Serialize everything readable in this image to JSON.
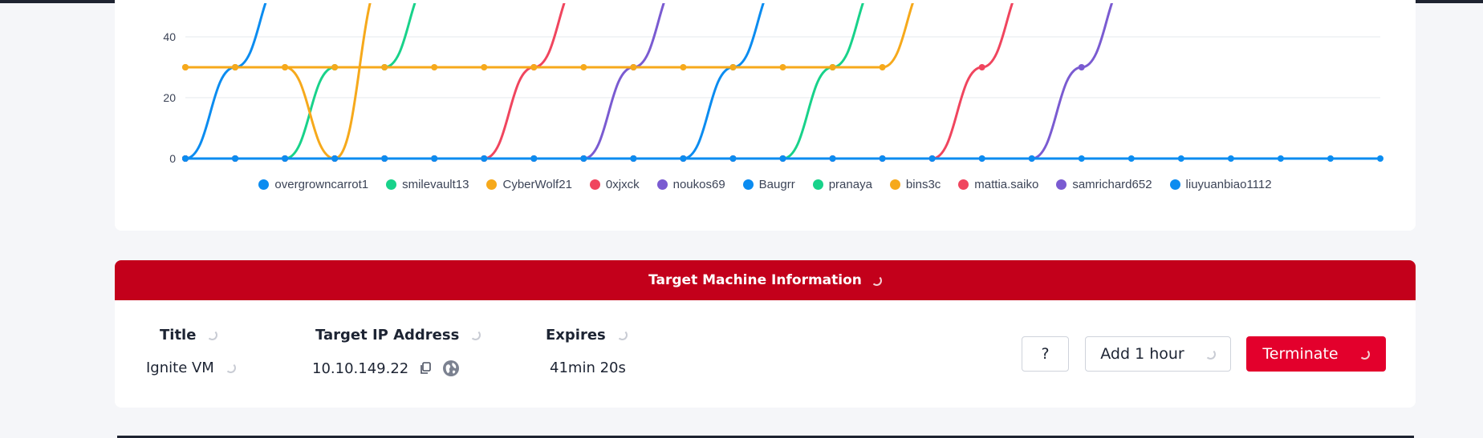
{
  "colors": {
    "blue": "#0b8cf0",
    "green": "#18d28a",
    "orange": "#f6a91b",
    "red": "#f0455e",
    "purple": "#7a5bd1",
    "header_red": "#c3001b",
    "terminate_red": "#e3002c"
  },
  "chart_data": {
    "type": "line",
    "y_ticks": [
      "0",
      "20",
      "40"
    ],
    "ylim": [
      0,
      50
    ],
    "x_count": 25,
    "grid": true,
    "legend_position": "bottom",
    "series": [
      {
        "name": "overgrowncarrot1",
        "color": "#0b8cf0",
        "values": [
          0,
          30,
          60,
          60,
          60,
          60,
          60,
          60,
          60,
          60,
          60,
          60,
          60,
          60,
          60,
          60,
          60,
          60,
          60,
          60,
          60,
          60,
          60,
          60,
          60
        ]
      },
      {
        "name": "smilevault13",
        "color": "#18d28a",
        "values": [
          0,
          0,
          0,
          30,
          30,
          60,
          60,
          60,
          60,
          60,
          60,
          60,
          60,
          60,
          60,
          60,
          60,
          60,
          60,
          60,
          60,
          60,
          60,
          60,
          60
        ]
      },
      {
        "name": "CyberWolf21",
        "color": "#f6a91b",
        "values": [
          30,
          30,
          30,
          0,
          60,
          60,
          60,
          60,
          60,
          60,
          60,
          60,
          60,
          60,
          60,
          60,
          60,
          60,
          60,
          60,
          60,
          60,
          60,
          60,
          60
        ]
      },
      {
        "name": "0xjxck",
        "color": "#f0455e",
        "values": [
          0,
          0,
          0,
          0,
          0,
          0,
          0,
          30,
          60,
          60,
          60,
          60,
          60,
          60,
          60,
          60,
          60,
          60,
          60,
          60,
          60,
          60,
          60,
          60,
          60
        ]
      },
      {
        "name": "noukos69",
        "color": "#7a5bd1",
        "values": [
          0,
          0,
          0,
          0,
          0,
          0,
          0,
          0,
          0,
          30,
          60,
          60,
          60,
          60,
          60,
          60,
          60,
          60,
          60,
          60,
          60,
          60,
          60,
          60,
          60
        ]
      },
      {
        "name": "Baugrr",
        "color": "#0b8cf0",
        "values": [
          0,
          0,
          0,
          0,
          0,
          0,
          0,
          0,
          0,
          0,
          0,
          30,
          60,
          60,
          60,
          60,
          60,
          60,
          60,
          60,
          60,
          60,
          60,
          60,
          60
        ]
      },
      {
        "name": "pranaya",
        "color": "#18d28a",
        "values": [
          0,
          0,
          0,
          0,
          0,
          0,
          0,
          0,
          0,
          0,
          0,
          0,
          0,
          30,
          60,
          60,
          60,
          60,
          60,
          60,
          60,
          60,
          60,
          60,
          60
        ]
      },
      {
        "name": "bins3c",
        "color": "#f6a91b",
        "values": [
          30,
          30,
          30,
          30,
          30,
          30,
          30,
          30,
          30,
          30,
          30,
          30,
          30,
          30,
          30,
          60,
          60,
          60,
          60,
          60,
          60,
          60,
          60,
          60,
          60
        ]
      },
      {
        "name": "mattia.saiko",
        "color": "#f0455e",
        "values": [
          0,
          0,
          0,
          0,
          0,
          0,
          0,
          0,
          0,
          0,
          0,
          0,
          0,
          0,
          0,
          0,
          30,
          60,
          60,
          60,
          60,
          60,
          60,
          60,
          60
        ]
      },
      {
        "name": "samrichard652",
        "color": "#7a5bd1",
        "values": [
          0,
          0,
          0,
          0,
          0,
          0,
          0,
          0,
          0,
          0,
          0,
          0,
          0,
          0,
          0,
          0,
          0,
          0,
          30,
          60,
          60,
          60,
          60,
          60,
          60
        ]
      },
      {
        "name": "liuyuanbiao1112",
        "color": "#0b8cf0",
        "values": [
          0,
          0,
          0,
          0,
          0,
          0,
          0,
          0,
          0,
          0,
          0,
          0,
          0,
          0,
          0,
          0,
          0,
          0,
          0,
          0,
          0,
          0,
          0,
          0,
          0
        ]
      }
    ]
  },
  "target_machine": {
    "header": "Target Machine Information",
    "title_label": "Title",
    "title_value": "Ignite VM",
    "ip_label": "Target IP Address",
    "ip_value": "10.10.149.22",
    "expires_label": "Expires",
    "expires_value": "41min 20s",
    "help_button": "?",
    "add_hour_button": "Add 1 hour",
    "terminate_button": "Terminate"
  }
}
